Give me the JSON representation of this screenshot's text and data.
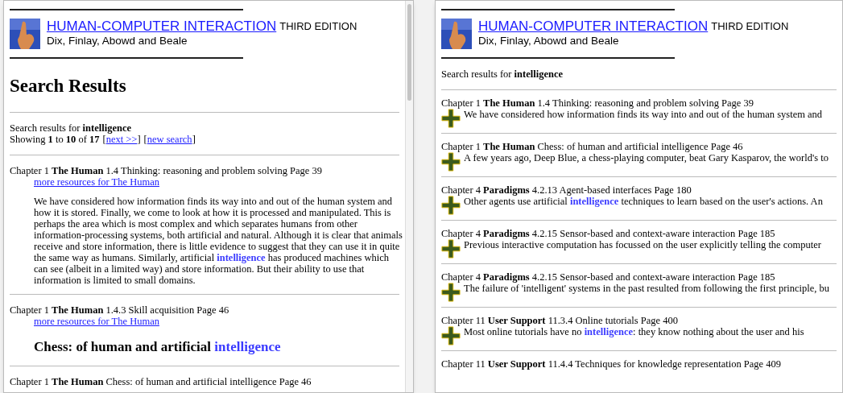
{
  "left_window": {
    "header": {
      "title": "HUMAN-COMPUTER INTERACTION",
      "edition": "THIRD EDITION",
      "authors": "Dix, Finlay, Abowd and Beale"
    },
    "heading": "Search Results",
    "query_line": "Search results for **intelligence**",
    "pagination": {
      "text": "Showing **1** to **10** of **17**",
      "links": [
        {
          "open": "[",
          "label": "next >>",
          "close": "]"
        },
        {
          "open": "[",
          "label": "new search",
          "close": "]"
        }
      ]
    },
    "results": [
      {
        "kind": "paragraph",
        "title": "Chapter 1 **The Human** 1.4 Thinking: reasoning and problem solving Page 39",
        "link": "more resources for The Human",
        "body": [
          {
            "kind": "text",
            "text": "We have considered how information finds its way into and out of the human system and how it is stored. Finally, we come to look at how it is processed and manipulated. This is perhaps the area which is most complex and which separates humans from other information-processing systems, both artificial and natural. Although it is clear that animals receive and store information, there is little evidence to suggest that they can use it in quite the same way as humans. Similarly, artificial "
          },
          {
            "kind": "match",
            "text": "intelligence"
          },
          {
            "kind": "text",
            "text": " has produced machines which can see (albeit in a limited way) and store information. But their ability to use that information is limited to small domains."
          }
        ]
      },
      {
        "kind": "heading",
        "title": "Chapter 1 **The Human** 1.4.3 Skill acquisition Page 46",
        "link": "more resources for The Human",
        "body": [
          {
            "kind": "text",
            "text": "Chess: of human and artificial "
          },
          {
            "kind": "match",
            "text": "intelligence"
          }
        ]
      },
      {
        "kind": "title_only",
        "title": "Chapter 1 **The Human** Chess: of human and artificial intelligence Page 46"
      }
    ]
  },
  "right_window": {
    "header": {
      "title": "HUMAN-COMPUTER INTERACTION",
      "edition": "THIRD EDITION",
      "authors": "Dix, Finlay, Abowd and Beale"
    },
    "query_line": "Search results for **intelligence**",
    "results": [
      {
        "title": "Chapter 1 **The Human** 1.4 Thinking: reasoning and problem solving Page 39",
        "snippet": [
          {
            "kind": "text",
            "text": "We have considered how information finds its way into and out of the human system and"
          }
        ]
      },
      {
        "title": "Chapter 1 **The Human** Chess: of human and artificial intelligence Page 46",
        "snippet": [
          {
            "kind": "text",
            "text": "A few years ago, Deep Blue, a chess-playing computer, beat Gary Kasparov, the world's to"
          }
        ]
      },
      {
        "title": "Chapter 4 **Paradigms** 4.2.13 Agent-based interfaces Page 180",
        "snippet": [
          {
            "kind": "text",
            "text": "Other agents use artificial "
          },
          {
            "kind": "match",
            "text": "intelligence"
          },
          {
            "kind": "text",
            "text": " techniques to learn based on the user's actions. An"
          }
        ]
      },
      {
        "title": "Chapter 4 **Paradigms** 4.2.15 Sensor-based and context-aware interaction Page 185",
        "snippet": [
          {
            "kind": "text",
            "text": "Previous interactive computation has focussed on the user explicitly telling the computer"
          }
        ]
      },
      {
        "title": "Chapter 4 **Paradigms** 4.2.15 Sensor-based and context-aware interaction Page 185",
        "snippet": [
          {
            "kind": "text",
            "text": "The failure of 'intelligent' systems in the past resulted from following the first principle, bu"
          }
        ]
      },
      {
        "title": "Chapter 11 **User Support** 11.3.4 Online tutorials Page 400",
        "snippet": [
          {
            "kind": "text",
            "text": "Most online tutorials have no "
          },
          {
            "kind": "match",
            "text": "intelligence"
          },
          {
            "kind": "text",
            "text": ": they know nothing about the user and his"
          }
        ]
      },
      {
        "title": "Chapter 11 **User Support** 11.4.4 Techniques for knowledge representation Page 409"
      }
    ]
  }
}
